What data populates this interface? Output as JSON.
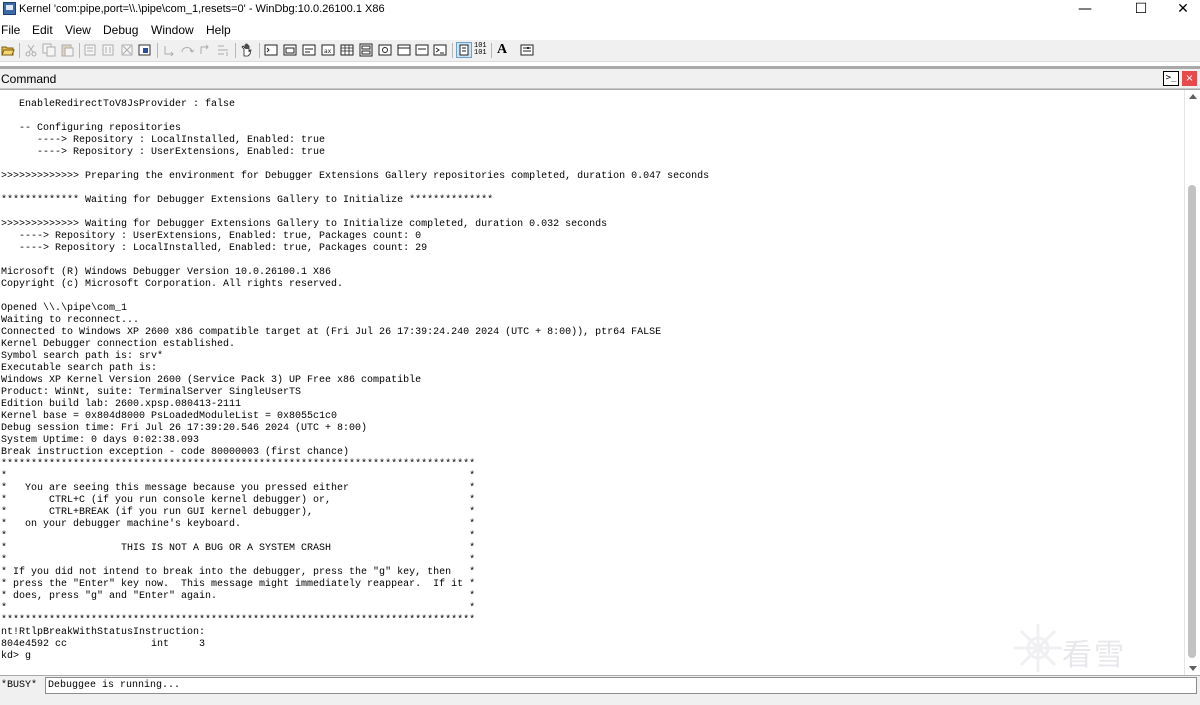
{
  "window": {
    "title": "Kernel 'com:pipe,port=\\\\.\\pipe\\com_1,resets=0' - WinDbg:10.0.26100.1 X86",
    "minimize": "—",
    "maximize": "☐",
    "close": "✕"
  },
  "menu": [
    "File",
    "Edit",
    "View",
    "Debug",
    "Window",
    "Help"
  ],
  "toolbar": {
    "icons": [
      "open-icon",
      "cut-icon",
      "copy-icon",
      "paste-icon",
      "go-icon",
      "restart-icon",
      "stop-icon",
      "break-icon",
      "step-into-icon",
      "step-over-icon",
      "step-out-icon",
      "run-to-cursor-icon",
      "hand-icon",
      "command-window-icon",
      "watch-window-icon",
      "locals-window-icon",
      "registers-window-icon",
      "memory-window-icon",
      "call-stack-window-icon",
      "disassembly-window-icon",
      "scratch-pad-icon",
      "processes-threads-icon",
      "source-mode-icon",
      "hex-mode-icon",
      "font-icon",
      "options-icon"
    ],
    "hex_label_top": "101",
    "hex_label_bottom": "101",
    "font_label": "A"
  },
  "command_window": {
    "title": "Command",
    "console_button": ">_",
    "close_button": "×",
    "output": "   EnableRedirectToV8JsProvider : false\n\n   -- Configuring repositories\n      ----> Repository : LocalInstalled, Enabled: true\n      ----> Repository : UserExtensions, Enabled: true\n\n>>>>>>>>>>>>> Preparing the environment for Debugger Extensions Gallery repositories completed, duration 0.047 seconds\n\n************* Waiting for Debugger Extensions Gallery to Initialize **************\n\n>>>>>>>>>>>>> Waiting for Debugger Extensions Gallery to Initialize completed, duration 0.032 seconds\n   ----> Repository : UserExtensions, Enabled: true, Packages count: 0\n   ----> Repository : LocalInstalled, Enabled: true, Packages count: 29\n\nMicrosoft (R) Windows Debugger Version 10.0.26100.1 X86\nCopyright (c) Microsoft Corporation. All rights reserved.\n\nOpened \\\\.\\pipe\\com_1\nWaiting to reconnect...\nConnected to Windows XP 2600 x86 compatible target at (Fri Jul 26 17:39:24.240 2024 (UTC + 8:00)), ptr64 FALSE\nKernel Debugger connection established.\nSymbol search path is: srv*\nExecutable search path is:\nWindows XP Kernel Version 2600 (Service Pack 3) UP Free x86 compatible\nProduct: WinNt, suite: TerminalServer SingleUserTS\nEdition build lab: 2600.xpsp.080413-2111\nKernel base = 0x804d8000 PsLoadedModuleList = 0x8055c1c0\nDebug session time: Fri Jul 26 17:39:20.546 2024 (UTC + 8:00)\nSystem Uptime: 0 days 0:02:38.093\nBreak instruction exception - code 80000003 (first chance)\n*******************************************************************************\n*                                                                             *\n*   You are seeing this message because you pressed either                    *\n*       CTRL+C (if you run console kernel debugger) or,                       *\n*       CTRL+BREAK (if you run GUI kernel debugger),                          *\n*   on your debugger machine's keyboard.                                      *\n*                                                                             *\n*                   THIS IS NOT A BUG OR A SYSTEM CRASH                       *\n*                                                                             *\n* If you did not intend to break into the debugger, press the \"g\" key, then   *\n* press the \"Enter\" key now.  This message might immediately reappear.  If it *\n* does, press \"g\" and \"Enter\" again.                                          *\n*                                                                             *\n*******************************************************************************\nnt!RtlpBreakWithStatusInstruction:\n804e4592 cc              int     3\nkd> g",
    "prompt": "*BUSY*",
    "input_value": "Debuggee is running..."
  },
  "watermark": "看雪",
  "colors": {
    "close_red": "#e64a4a",
    "window_frame_gray": "#a9a9a9",
    "toolbar_bg": "#f0f0f0"
  }
}
